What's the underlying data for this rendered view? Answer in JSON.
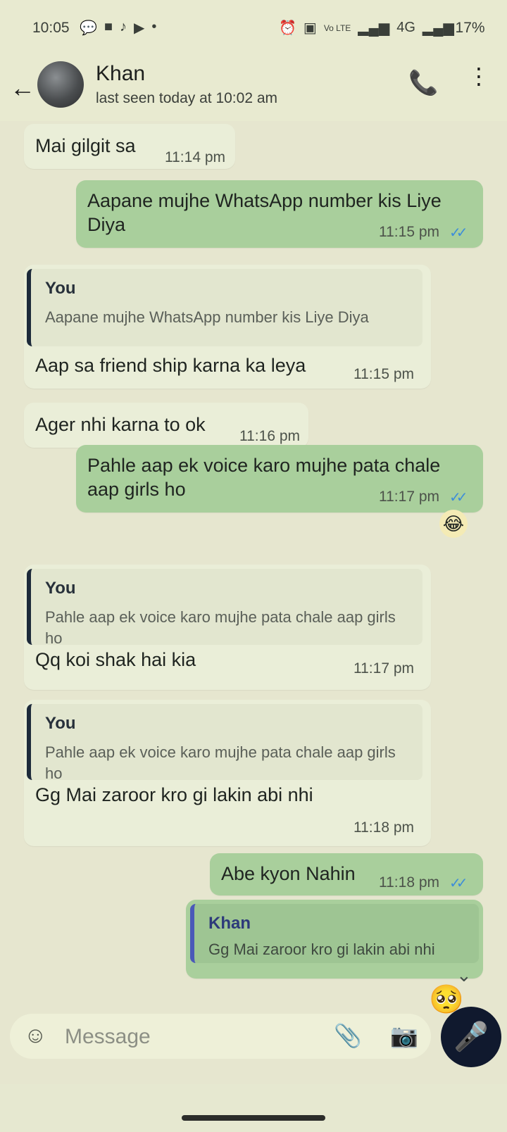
{
  "status_bar": {
    "time": "10:05",
    "left_icons": [
      "chat-icon",
      "video-icon",
      "tiktok-icon",
      "youtube-icon",
      "dot-icon"
    ],
    "right_icons": [
      "alarm-icon",
      "cast-icon",
      "volte-icon",
      "signal-icon",
      "4g-icon",
      "signal-icon-2"
    ],
    "network": "4G",
    "battery": "17%"
  },
  "header": {
    "contact_name": "Khan",
    "last_seen": "last seen today at 10:02 am"
  },
  "messages": [
    {
      "dir": "in",
      "text": "Mai gilgit sa",
      "time": "11:14 pm"
    },
    {
      "dir": "out",
      "text": "Aapane mujhe WhatsApp number kis Liye Diya",
      "time": "11:15 pm",
      "ticks": "✓✓"
    },
    {
      "dir": "in",
      "quote_name": "You",
      "quote_text": "Aapane mujhe WhatsApp number kis Liye Diya",
      "text": "Aap sa friend ship karna ka leya",
      "time": "11:15 pm"
    },
    {
      "dir": "in",
      "text": "Ager nhi karna to ok",
      "time": "11:16 pm"
    },
    {
      "dir": "out",
      "text": "Pahle aap ek voice karo mujhe pata chale aap girls ho",
      "time": "11:17 pm",
      "ticks": "✓✓",
      "reaction": "😂"
    },
    {
      "dir": "in",
      "quote_name": "You",
      "quote_text": "Pahle aap ek voice karo mujhe pata chale aap girls ho",
      "text": "Qq koi shak hai kia",
      "time": "11:17 pm"
    },
    {
      "dir": "in",
      "quote_name": "You",
      "quote_text": "Pahle aap ek voice karo mujhe pata chale aap girls ho",
      "text": "Gg Mai zaroor kro gi lakin abi nhi",
      "time": "11:18 pm"
    },
    {
      "dir": "out",
      "text": "Abe kyon Nahin",
      "time": "11:18 pm",
      "ticks": "✓✓"
    },
    {
      "dir": "out",
      "quote_name": "Khan",
      "quote_text": "Gg Mai zaroor kro gi lakin abi nhi"
    }
  ],
  "composer": {
    "placeholder": "Message"
  }
}
